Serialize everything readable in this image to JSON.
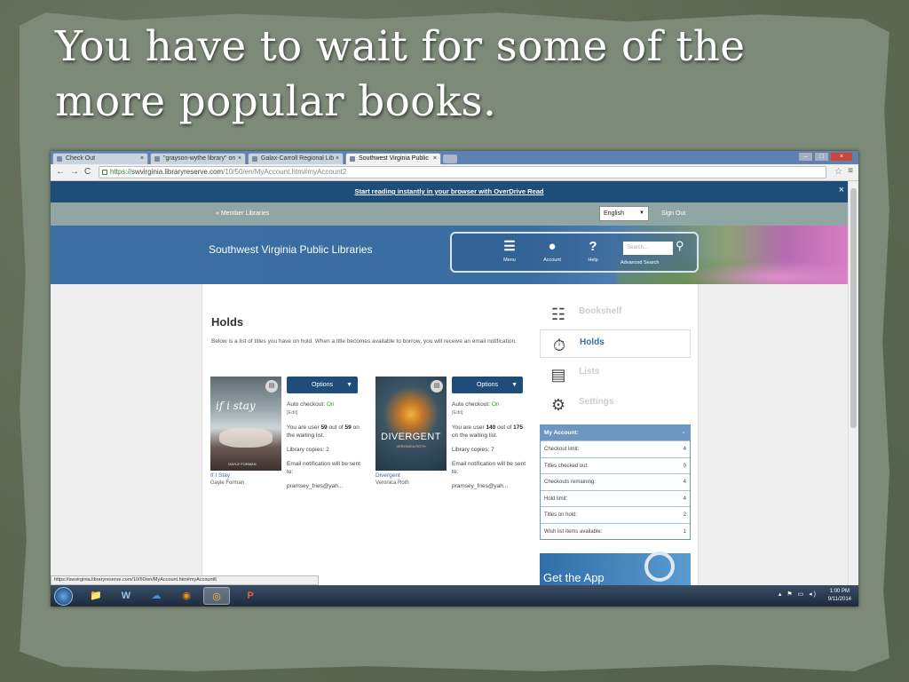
{
  "slide": {
    "title": "You have to wait for some of the more popular books."
  },
  "browser": {
    "tabs": [
      {
        "label": "Check Out",
        "active": false
      },
      {
        "label": "\"grayson-wythe library\" on",
        "active": false
      },
      {
        "label": "Galax-Carroll Regional Lib",
        "active": false
      },
      {
        "label": "Southwest Virginia Public",
        "active": true
      }
    ],
    "url_secure": "https://",
    "url_host": "swvirginia.libraryreserve.com",
    "url_path": "/10/50/en/MyAccount.htm#myAccount2",
    "status_url": "https://swvirginia.libraryreserve.com/10/50/en/MyAccount.htm#myAccount6"
  },
  "site": {
    "promo": "Start reading instantly in your browser with OverDrive Read",
    "member_link": "« Member Libraries",
    "language": "English",
    "sign_out": "Sign Out",
    "name": "Southwest Virginia Public Libraries",
    "nav": {
      "menu": "Menu",
      "account": "Account",
      "help": "Help",
      "search_placeholder": "Search...",
      "advanced_search": "Advanced Search"
    }
  },
  "holds": {
    "title": "Holds",
    "description": "Below is a list of titles you have on hold. When a title becomes available to borrow, you will receive an email notification.",
    "options_label": "Options",
    "auto_checkout_label": "Auto checkout:",
    "edit_label": "[Edit]",
    "items": [
      {
        "cover_title": "if i stay",
        "cover_author": "GAYLE FORMAN",
        "title": "If I Stay",
        "author": "Gayle Forman",
        "auto_checkout": "On",
        "position_pre": "You are user ",
        "position": "59",
        "position_mid": " out of ",
        "total": "59",
        "position_post": " on the waiting list.",
        "copies": "Library copies: 2",
        "email_label": "Email notification will be sent to:",
        "email": "pramsey_fries@yah..."
      },
      {
        "cover_title": "DIVERGENT",
        "cover_author": "VERONICA ROTH",
        "title": "Divergent",
        "author": "Veronica Roth",
        "auto_checkout": "On",
        "position_pre": "You are user ",
        "position": "140",
        "position_mid": " out of ",
        "total": "175",
        "position_post": " on the waiting list.",
        "copies": "Library copies: 7",
        "email_label": "Email notification will be sent to:",
        "email": "pramsey_fries@yah..."
      }
    ]
  },
  "sidebar": {
    "items": [
      {
        "label": "Bookshelf",
        "icon": "bookshelf-icon",
        "active": false
      },
      {
        "label": "Holds",
        "icon": "stopwatch-icon",
        "active": true
      },
      {
        "label": "Lists",
        "icon": "clipboard-icon",
        "active": false
      },
      {
        "label": "Settings",
        "icon": "gear-icon",
        "active": false
      }
    ],
    "account": {
      "header": "My Account:",
      "collapse": "-",
      "rows": [
        {
          "label": "Checkout limit:",
          "value": "4"
        },
        {
          "label": "Titles checked out:",
          "value": "0"
        },
        {
          "label": "Checkouts remaining:",
          "value": "4"
        },
        {
          "label": "Hold limit:",
          "value": "4"
        },
        {
          "label": "Titles on hold:",
          "value": "2"
        },
        {
          "label": "Wish list items available:",
          "value": "1"
        }
      ]
    },
    "get_app": "Get the App"
  },
  "taskbar": {
    "time": "1:00 PM",
    "date": "9/11/2014"
  }
}
